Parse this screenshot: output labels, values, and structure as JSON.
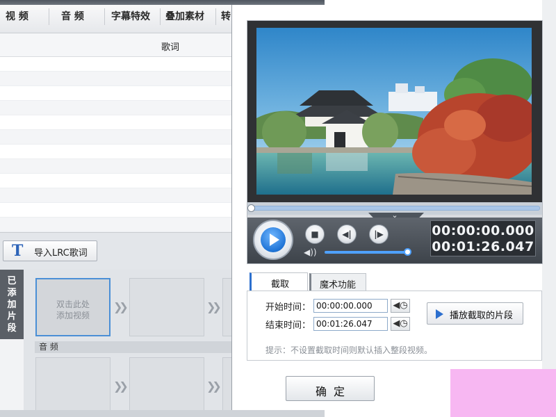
{
  "editor_tabs": [
    "视 频",
    "音 频",
    "字幕特效",
    "叠加素材",
    "转"
  ],
  "lyrics_panel": {
    "header": "歌词"
  },
  "import_button": {
    "icon": "T",
    "label": "导入LRC歌词"
  },
  "added_segments": {
    "label": "已添加片段"
  },
  "timeline": {
    "placeholder_line1": "双击此处",
    "placeholder_line2": "添加视频",
    "audio_label": "音 频"
  },
  "player": {
    "current_time": "00:00:00.000",
    "total_time": "00:01:26.047",
    "volume_fraction": 0.95,
    "progress_fraction": 0.0
  },
  "dialog_tabs": {
    "clip": "截取",
    "magic": "魔术功能"
  },
  "clip_form": {
    "start_label": "开始时间：",
    "start_value": "00:00:00.000",
    "end_label": "结束时间：",
    "end_value": "00:01:26.047",
    "play_segment_label": "播放截取的片段",
    "hint": "提示：不设置截取时间则默认插入整段视频。"
  },
  "confirm_label": "确定",
  "colors": {
    "accent_blue": "#2c6fce",
    "control_bar": "#4a5058",
    "overlay_pink": "#f7b7f2"
  }
}
